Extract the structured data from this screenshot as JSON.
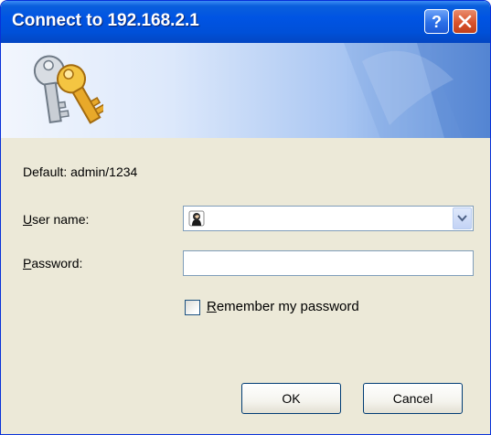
{
  "window": {
    "title": "Connect to 192.168.2.1",
    "help_icon": "question-mark-icon",
    "close_icon": "close-x-icon"
  },
  "banner": {
    "icon": "keys-icon"
  },
  "form": {
    "hint": "Default: admin/1234",
    "username_label_first": "U",
    "username_label_rest": "ser name:",
    "username_value": "",
    "username_icon": "user-account-icon",
    "password_label_first": "P",
    "password_label_rest": "assword:",
    "password_value": "",
    "remember_label_first": "R",
    "remember_label_rest": "emember my password",
    "remember_checked": false
  },
  "buttons": {
    "ok": "OK",
    "cancel": "Cancel"
  },
  "colors": {
    "titlebar": "#0054e3",
    "dialog_bg": "#ece9d8",
    "close_button": "#d9532c",
    "field_border": "#7f9db9"
  }
}
